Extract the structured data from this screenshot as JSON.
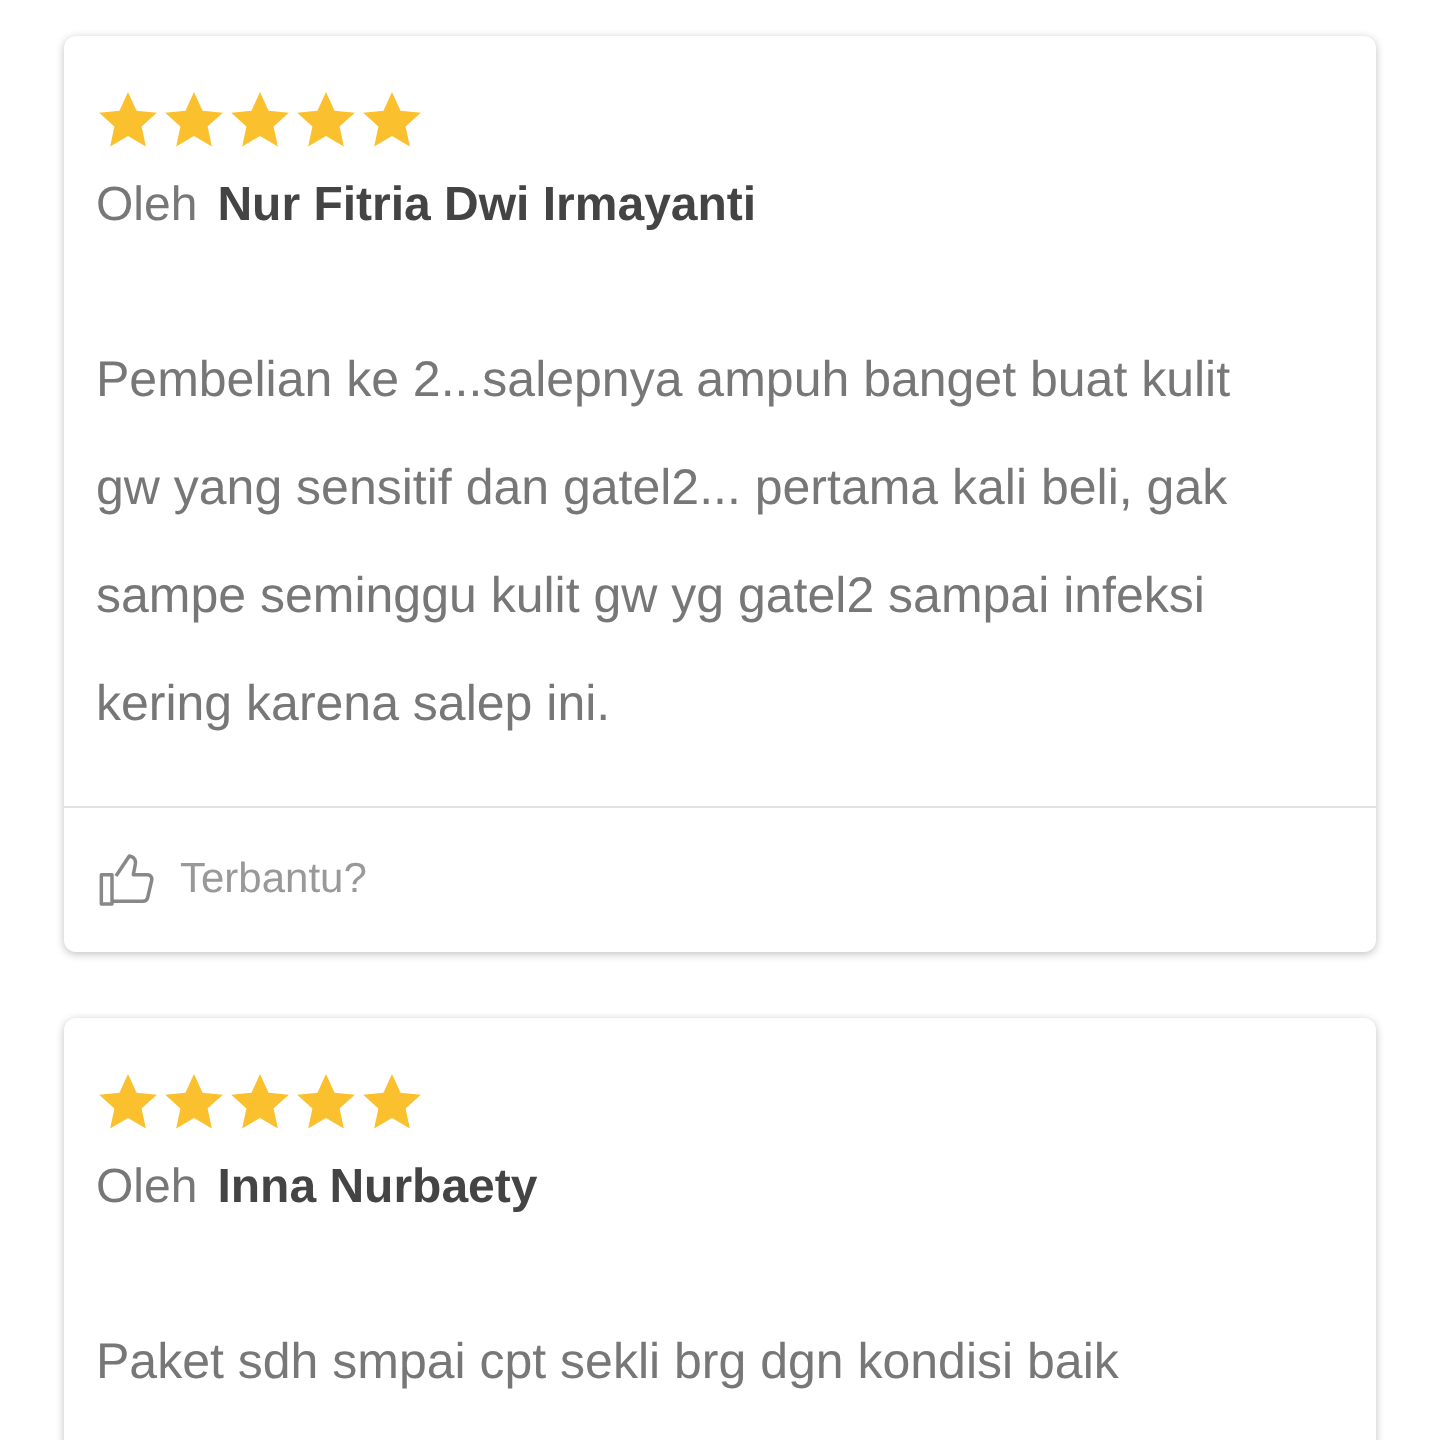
{
  "reviews": [
    {
      "stars": 5,
      "by_label": "Oleh",
      "author": "Nur Fitria Dwi Irmayanti",
      "text": "Pembelian ke 2...salepnya ampuh banget buat kulit gw yang sensitif dan gatel2... pertama kali beli, gak sampe seminggu kulit gw yg gatel2 sampai infeksi kering karena salep ini.",
      "helpful_label": "Terbantu?"
    },
    {
      "stars": 5,
      "by_label": "Oleh",
      "author": "Inna Nurbaety",
      "text": "Paket sdh smpai cpt sekli brg dgn kondisi baik"
    }
  ]
}
